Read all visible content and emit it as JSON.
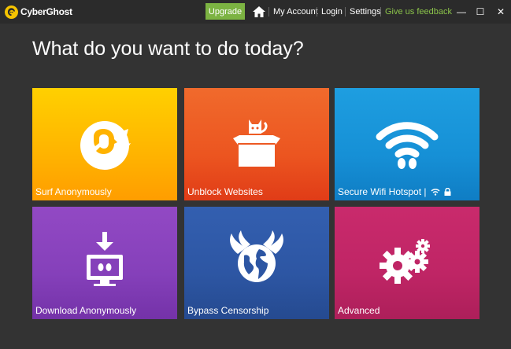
{
  "titlebar": {
    "app_name": "CyberGhost",
    "upgrade_label": "Upgrade",
    "home_icon": "home-icon",
    "menu": {
      "my_account": "My Account",
      "login": "Login",
      "settings": "Settings",
      "feedback": "Give us feedback"
    },
    "window_controls": {
      "minimize": "—",
      "maximize": "☐",
      "close": "✕"
    }
  },
  "main": {
    "headline": "What do you want to do today?",
    "tiles": [
      {
        "label": "Surf Anonymously",
        "icon": "ghost-icon",
        "color": "#ffb300"
      },
      {
        "label": "Unblock Websites",
        "icon": "cat-in-box-icon",
        "color": "#ec5520"
      },
      {
        "label": "Secure Wifi Hotspot |",
        "icon": "wifi-ghost-icon",
        "color": "#1690d6"
      },
      {
        "label": "Download Anonymously",
        "icon": "download-monitor-icon",
        "color": "#8540ba"
      },
      {
        "label": "Bypass Censorship",
        "icon": "winged-globe-icon",
        "color": "#2d56a3"
      },
      {
        "label": "Advanced",
        "icon": "gears-icon",
        "color": "#bf2565"
      }
    ]
  },
  "colors": {
    "background": "#333333",
    "titlebar": "#2b2b2b",
    "upgrade": "#7cb342",
    "feedback": "#8bc34a"
  }
}
